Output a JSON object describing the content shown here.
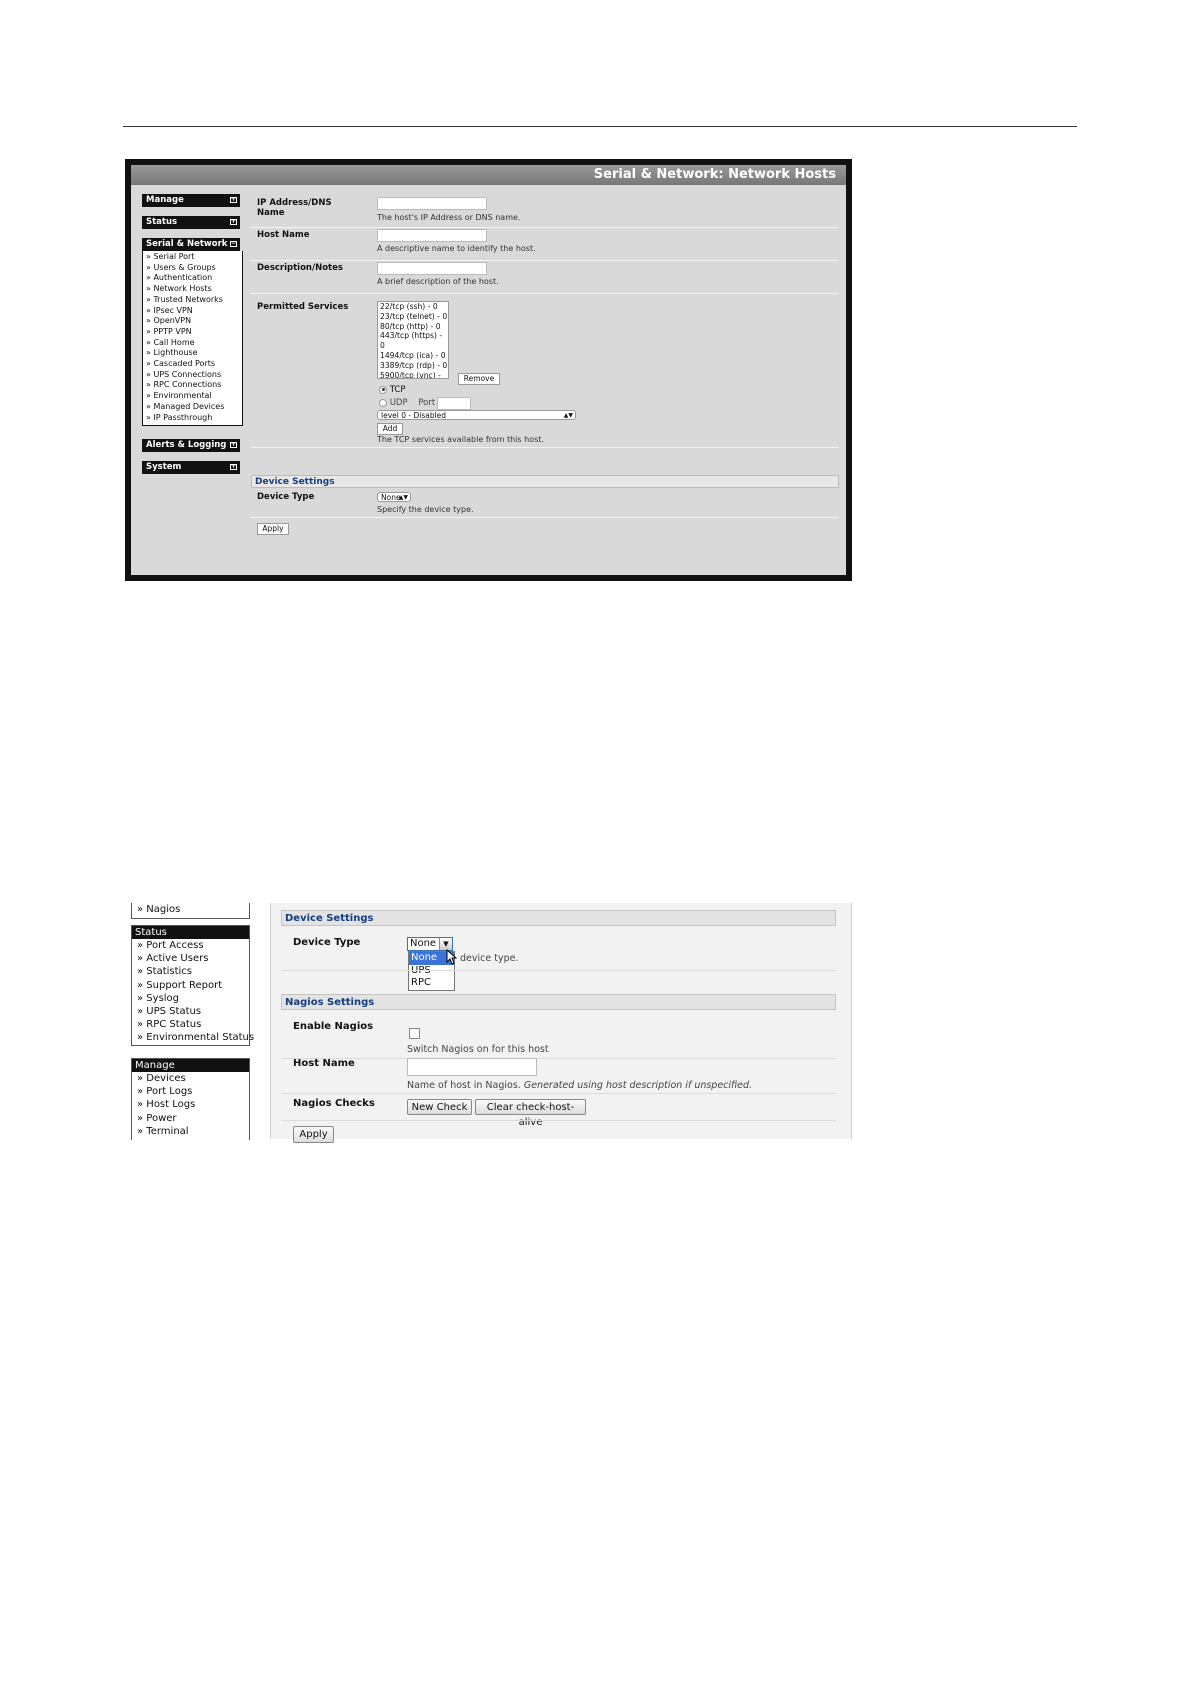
{
  "shot1": {
    "title": "Serial & Network: Network Hosts",
    "sidebar": {
      "manage": "Manage",
      "status": "Status",
      "serial_network": "Serial & Network",
      "serial_items": [
        "Serial Port",
        "Users & Groups",
        "Authentication",
        "Network Hosts",
        "Trusted Networks",
        "IPsec VPN",
        "OpenVPN",
        "PPTP VPN",
        "Call Home",
        "Lighthouse",
        "Cascaded Ports",
        "UPS Connections",
        "RPC Connections",
        "Environmental",
        "Managed Devices",
        "IP Passthrough"
      ],
      "alerts_logging": "Alerts & Logging",
      "system": "System",
      "bullet": "»"
    },
    "form": {
      "ip_label": "IP Address/DNS Name",
      "ip_help": "The host's IP Address or DNS name.",
      "hostname_label": "Host Name",
      "hostname_help": "A descriptive name to identify the host.",
      "desc_label": "Description/Notes",
      "desc_help": "A brief description of the host.",
      "services_label": "Permitted Services",
      "services": [
        "22/tcp (ssh) - 0",
        "23/tcp (telnet) - 0",
        "80/tcp (http) - 0",
        "443/tcp (https) - 0",
        "1494/tcp (ica) - 0",
        "3389/tcp (rdp) - 0",
        "5900/tcp (vnc) - 0"
      ],
      "remove": "Remove",
      "tcp": "TCP",
      "udp": "UDP",
      "port": "Port",
      "level_select": "level 0 - Disabled",
      "add": "Add",
      "services_help": "The TCP services available from this host.",
      "device_settings": "Device Settings",
      "device_type_label": "Device Type",
      "device_type_value": "None",
      "device_type_help": "Specify the device type.",
      "apply": "Apply"
    }
  },
  "shot2": {
    "sidebar": {
      "nagios": "Nagios",
      "status_hdr": "Status",
      "status_items": [
        "Port Access",
        "Active Users",
        "Statistics",
        "Support Report",
        "Syslog",
        "UPS Status",
        "RPC Status",
        "Environmental Status"
      ],
      "manage_hdr": "Manage",
      "manage_items": [
        "Devices",
        "Port Logs",
        "Host Logs",
        "Power",
        "Terminal"
      ],
      "bullet": "»"
    },
    "device_settings": "Device Settings",
    "device_type_label": "Device Type",
    "device_type_value": "None",
    "device_type_options": [
      "None",
      "UPS",
      "RPC"
    ],
    "device_type_help": "device type.",
    "nagios_settings": "Nagios Settings",
    "enable_nagios_label": "Enable Nagios",
    "enable_nagios_help": "Switch Nagios on for this host",
    "host_name_label": "Host Name",
    "host_name_help": "Name of host in Nagios.",
    "host_name_help_italic": "Generated using host description if unspecified.",
    "nagios_checks_label": "Nagios Checks",
    "new_check": "New Check",
    "clear_check": "Clear check-host-alive",
    "apply": "Apply"
  }
}
